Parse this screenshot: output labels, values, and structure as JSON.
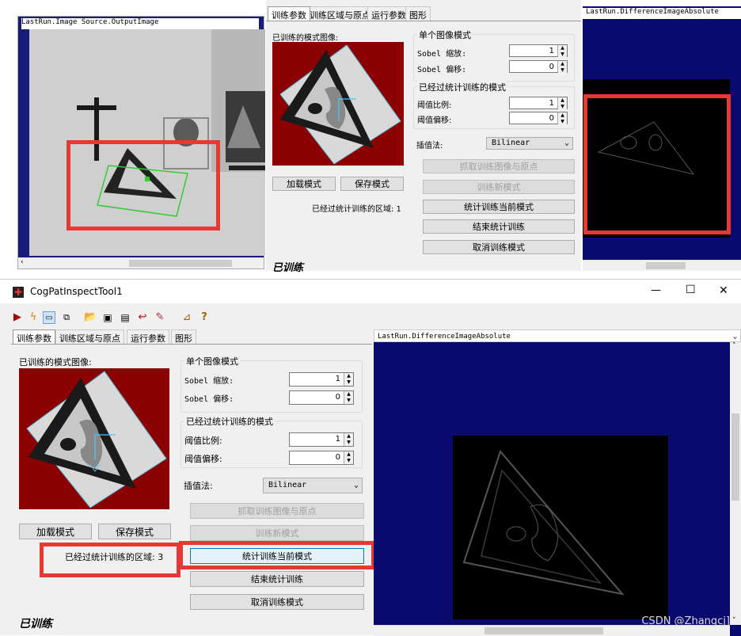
{
  "top": {
    "left_view_title": "LastRun.Image Source.OutputImage",
    "tabs": [
      "训练参数",
      "训练区域与原点",
      "运行参数",
      "图形"
    ],
    "trained_image_label": "已训练的模式图像:",
    "load_button": "加载模式",
    "save_button": "保存模式",
    "stat_region_label": "已经过统计训练的区域: 1",
    "group_single": "单个图像模式",
    "sobel_scale_label": "Sobel 缩放:",
    "sobel_scale_value": "1",
    "sobel_offset_label": "Sobel 偏移:",
    "sobel_offset_value": "0",
    "group_stat": "已经过统计训练的模式",
    "threshold_ratio_label": "阈值比例:",
    "threshold_ratio_value": "1",
    "threshold_offset_label": "阈值偏移:",
    "threshold_offset_value": "0",
    "interp_label": "插值法:",
    "interp_value": "Bilinear",
    "btn_grab": "抓取训练图像与原点",
    "btn_train_new": "训练新模式",
    "btn_stat_train": "统计训练当前模式",
    "btn_end_stat": "结束统计训练",
    "btn_cancel": "取消训练模式",
    "status": "已训练",
    "right_view_title": "LastRun.DifferenceImageAbsolute"
  },
  "window": {
    "title": "CogPatInspectTool1",
    "minimize": "—",
    "maximize": "☐",
    "close": "✕"
  },
  "bottom": {
    "tabs": [
      "训练参数",
      "训练区域与原点",
      "运行参数",
      "图形"
    ],
    "trained_image_label": "已训练的模式图像:",
    "load_button": "加载模式",
    "save_button": "保存模式",
    "stat_region_label": "已经过统计训练的区域: 3",
    "group_single": "单个图像模式",
    "sobel_scale_label": "Sobel 缩放:",
    "sobel_scale_value": "1",
    "sobel_offset_label": "Sobel 偏移:",
    "sobel_offset_value": "0",
    "group_stat": "已经过统计训练的模式",
    "threshold_ratio_label": "阈值比例:",
    "threshold_ratio_value": "1",
    "threshold_offset_label": "阈值偏移:",
    "threshold_offset_value": "0",
    "interp_label": "插值法:",
    "interp_value": "Bilinear",
    "btn_grab": "抓取训练图像与原点",
    "btn_train_new": "训练新模式",
    "btn_stat_train": "统计训练当前模式",
    "btn_end_stat": "结束统计训练",
    "btn_cancel": "取消训练模式",
    "status": "已训练",
    "right_view_title": "LastRun.DifferenceImageAbsolute"
  },
  "watermark": "CSDN @Zhangcj]",
  "colors": {
    "highlight_red": "#e53935",
    "image_bg_red": "#8b0000",
    "navy": "#0a0a6e"
  }
}
